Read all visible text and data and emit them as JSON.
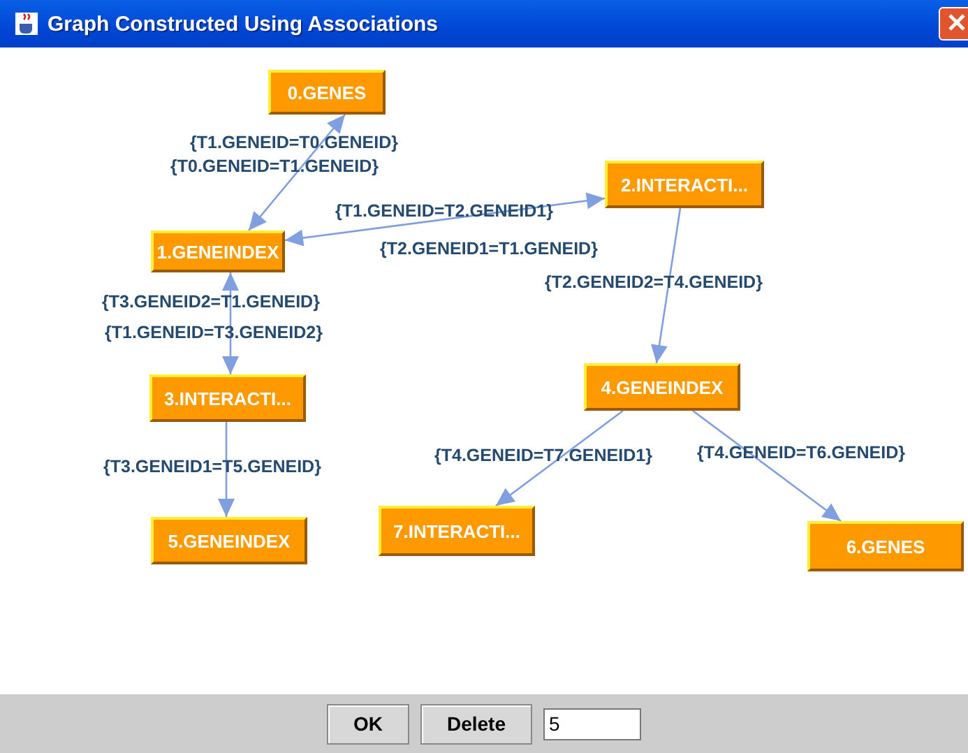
{
  "window": {
    "title": "Graph Constructed Using Associations"
  },
  "graph": {
    "nodes": [
      {
        "label": "0.GENES"
      },
      {
        "label": "1.GENEINDEX"
      },
      {
        "label": "2.INTERACTI..."
      },
      {
        "label": "3.INTERACTI..."
      },
      {
        "label": "4.GENEINDEX"
      },
      {
        "label": "5.GENEINDEX"
      },
      {
        "label": "6.GENES"
      },
      {
        "label": "7.INTERACTI..."
      }
    ],
    "edges": [
      {
        "kind": "two-way",
        "labels": [
          "{T1.GENEID=T0.GENEID}",
          "{T0.GENEID=T1.GENEID}"
        ]
      },
      {
        "kind": "two-way",
        "labels": [
          "{T1.GENEID=T2.GENEID1}",
          "{T2.GENEID1=T1.GENEID}"
        ]
      },
      {
        "kind": "one-way",
        "labels": [
          "{T2.GENEID2=T4.GENEID}"
        ]
      },
      {
        "kind": "two-way",
        "labels": [
          "{T3.GENEID2=T1.GENEID}",
          "{T1.GENEID=T3.GENEID2}"
        ]
      },
      {
        "kind": "one-way",
        "labels": [
          "{T3.GENEID1=T5.GENEID}"
        ]
      },
      {
        "kind": "one-way",
        "labels": [
          "{T4.GENEID=T7.GENEID1}"
        ]
      },
      {
        "kind": "one-way",
        "labels": [
          "{T4.GENEID=T6.GENEID}"
        ]
      }
    ]
  },
  "buttons": [
    "OK",
    "Delete"
  ],
  "count_field": {
    "value": "5"
  }
}
